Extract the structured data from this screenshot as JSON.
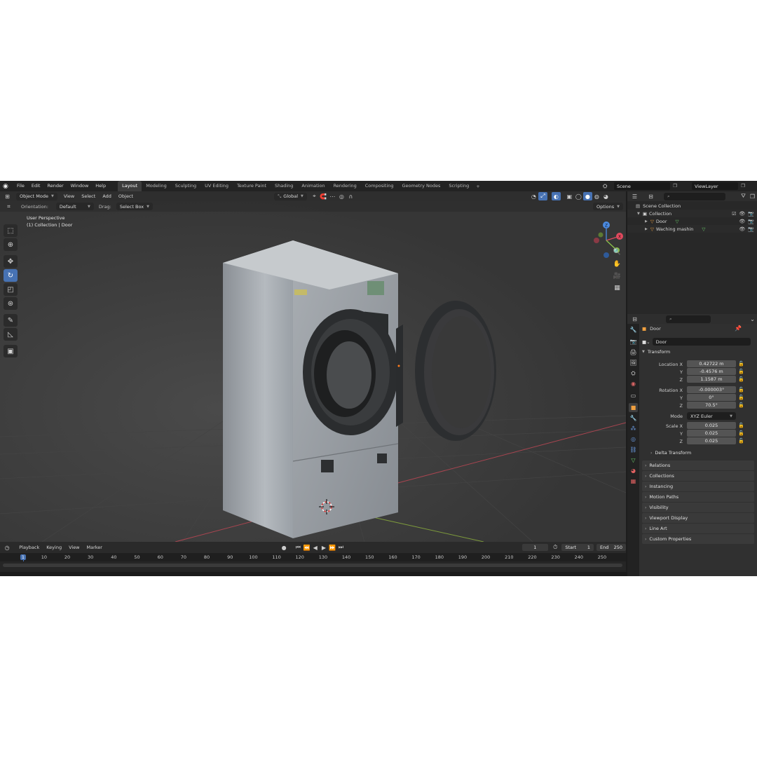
{
  "app": {
    "menus": [
      "File",
      "Edit",
      "Render",
      "Window",
      "Help"
    ],
    "workspaces": [
      "Layout",
      "Modeling",
      "Sculpting",
      "UV Editing",
      "Texture Paint",
      "Shading",
      "Animation",
      "Rendering",
      "Compositing",
      "Geometry Nodes",
      "Scripting"
    ],
    "active_workspace": "Layout",
    "scene": "Scene",
    "view_layer": "ViewLayer"
  },
  "viewport": {
    "mode": "Object Mode",
    "menus": [
      "View",
      "Select",
      "Add",
      "Object"
    ],
    "transform_orientation": "Global",
    "orientation_label": "Orientation:",
    "orientation_value": "Default",
    "drag_label": "Drag:",
    "drag_value": "Select Box",
    "options_label": "Options",
    "perspective_text": "User Perspective",
    "collection_text": "(1) Collection | Door",
    "gizmo_axes": {
      "x": "X",
      "y": "Y",
      "z": "Z"
    }
  },
  "tools": [
    "select-box",
    "cursor",
    "move",
    "rotate",
    "scale",
    "transform",
    "annotate",
    "measure",
    "add-cube"
  ],
  "active_tool": "rotate",
  "outliner": {
    "scene_collection": "Scene Collection",
    "collection": "Collection",
    "objects": [
      {
        "name": "Door"
      },
      {
        "name": "Waching mashin"
      }
    ]
  },
  "properties": {
    "object_name": "Door",
    "data_name": "Door",
    "transform_title": "Transform",
    "location_label": "Location X",
    "rotation_label": "Rotation X",
    "scale_label": "Scale X",
    "y_label": "Y",
    "z_label": "Z",
    "mode_label": "Mode",
    "location": {
      "x": "0.42722 m",
      "y": "-0.4576 m",
      "z": "1.1587 m"
    },
    "rotation": {
      "x": "-0.000003°",
      "y": "0°",
      "z": "70.5°"
    },
    "rotation_mode": "XYZ Euler",
    "scale": {
      "x": "0.025",
      "y": "0.025",
      "z": "0.025"
    },
    "delta_transform": "Delta Transform",
    "panels": [
      "Relations",
      "Collections",
      "Instancing",
      "Motion Paths",
      "Visibility",
      "Viewport Display",
      "Line Art",
      "Custom Properties"
    ]
  },
  "timeline": {
    "menus": [
      "Playback",
      "Keying",
      "View",
      "Marker"
    ],
    "current_frame": "1",
    "start_label": "Start",
    "start": "1",
    "end_label": "End",
    "end": "250",
    "ticks": [
      "1",
      "10",
      "20",
      "30",
      "40",
      "50",
      "60",
      "70",
      "80",
      "90",
      "100",
      "110",
      "120",
      "130",
      "140",
      "150",
      "160",
      "170",
      "180",
      "190",
      "200",
      "210",
      "220",
      "230",
      "240",
      "250"
    ]
  },
  "colors": {
    "accent": "#4772b3",
    "viewport_bg": "#393939",
    "axis_x": "#e04a5e",
    "axis_y": "#8bc34a",
    "axis_z": "#4b8ae0"
  }
}
